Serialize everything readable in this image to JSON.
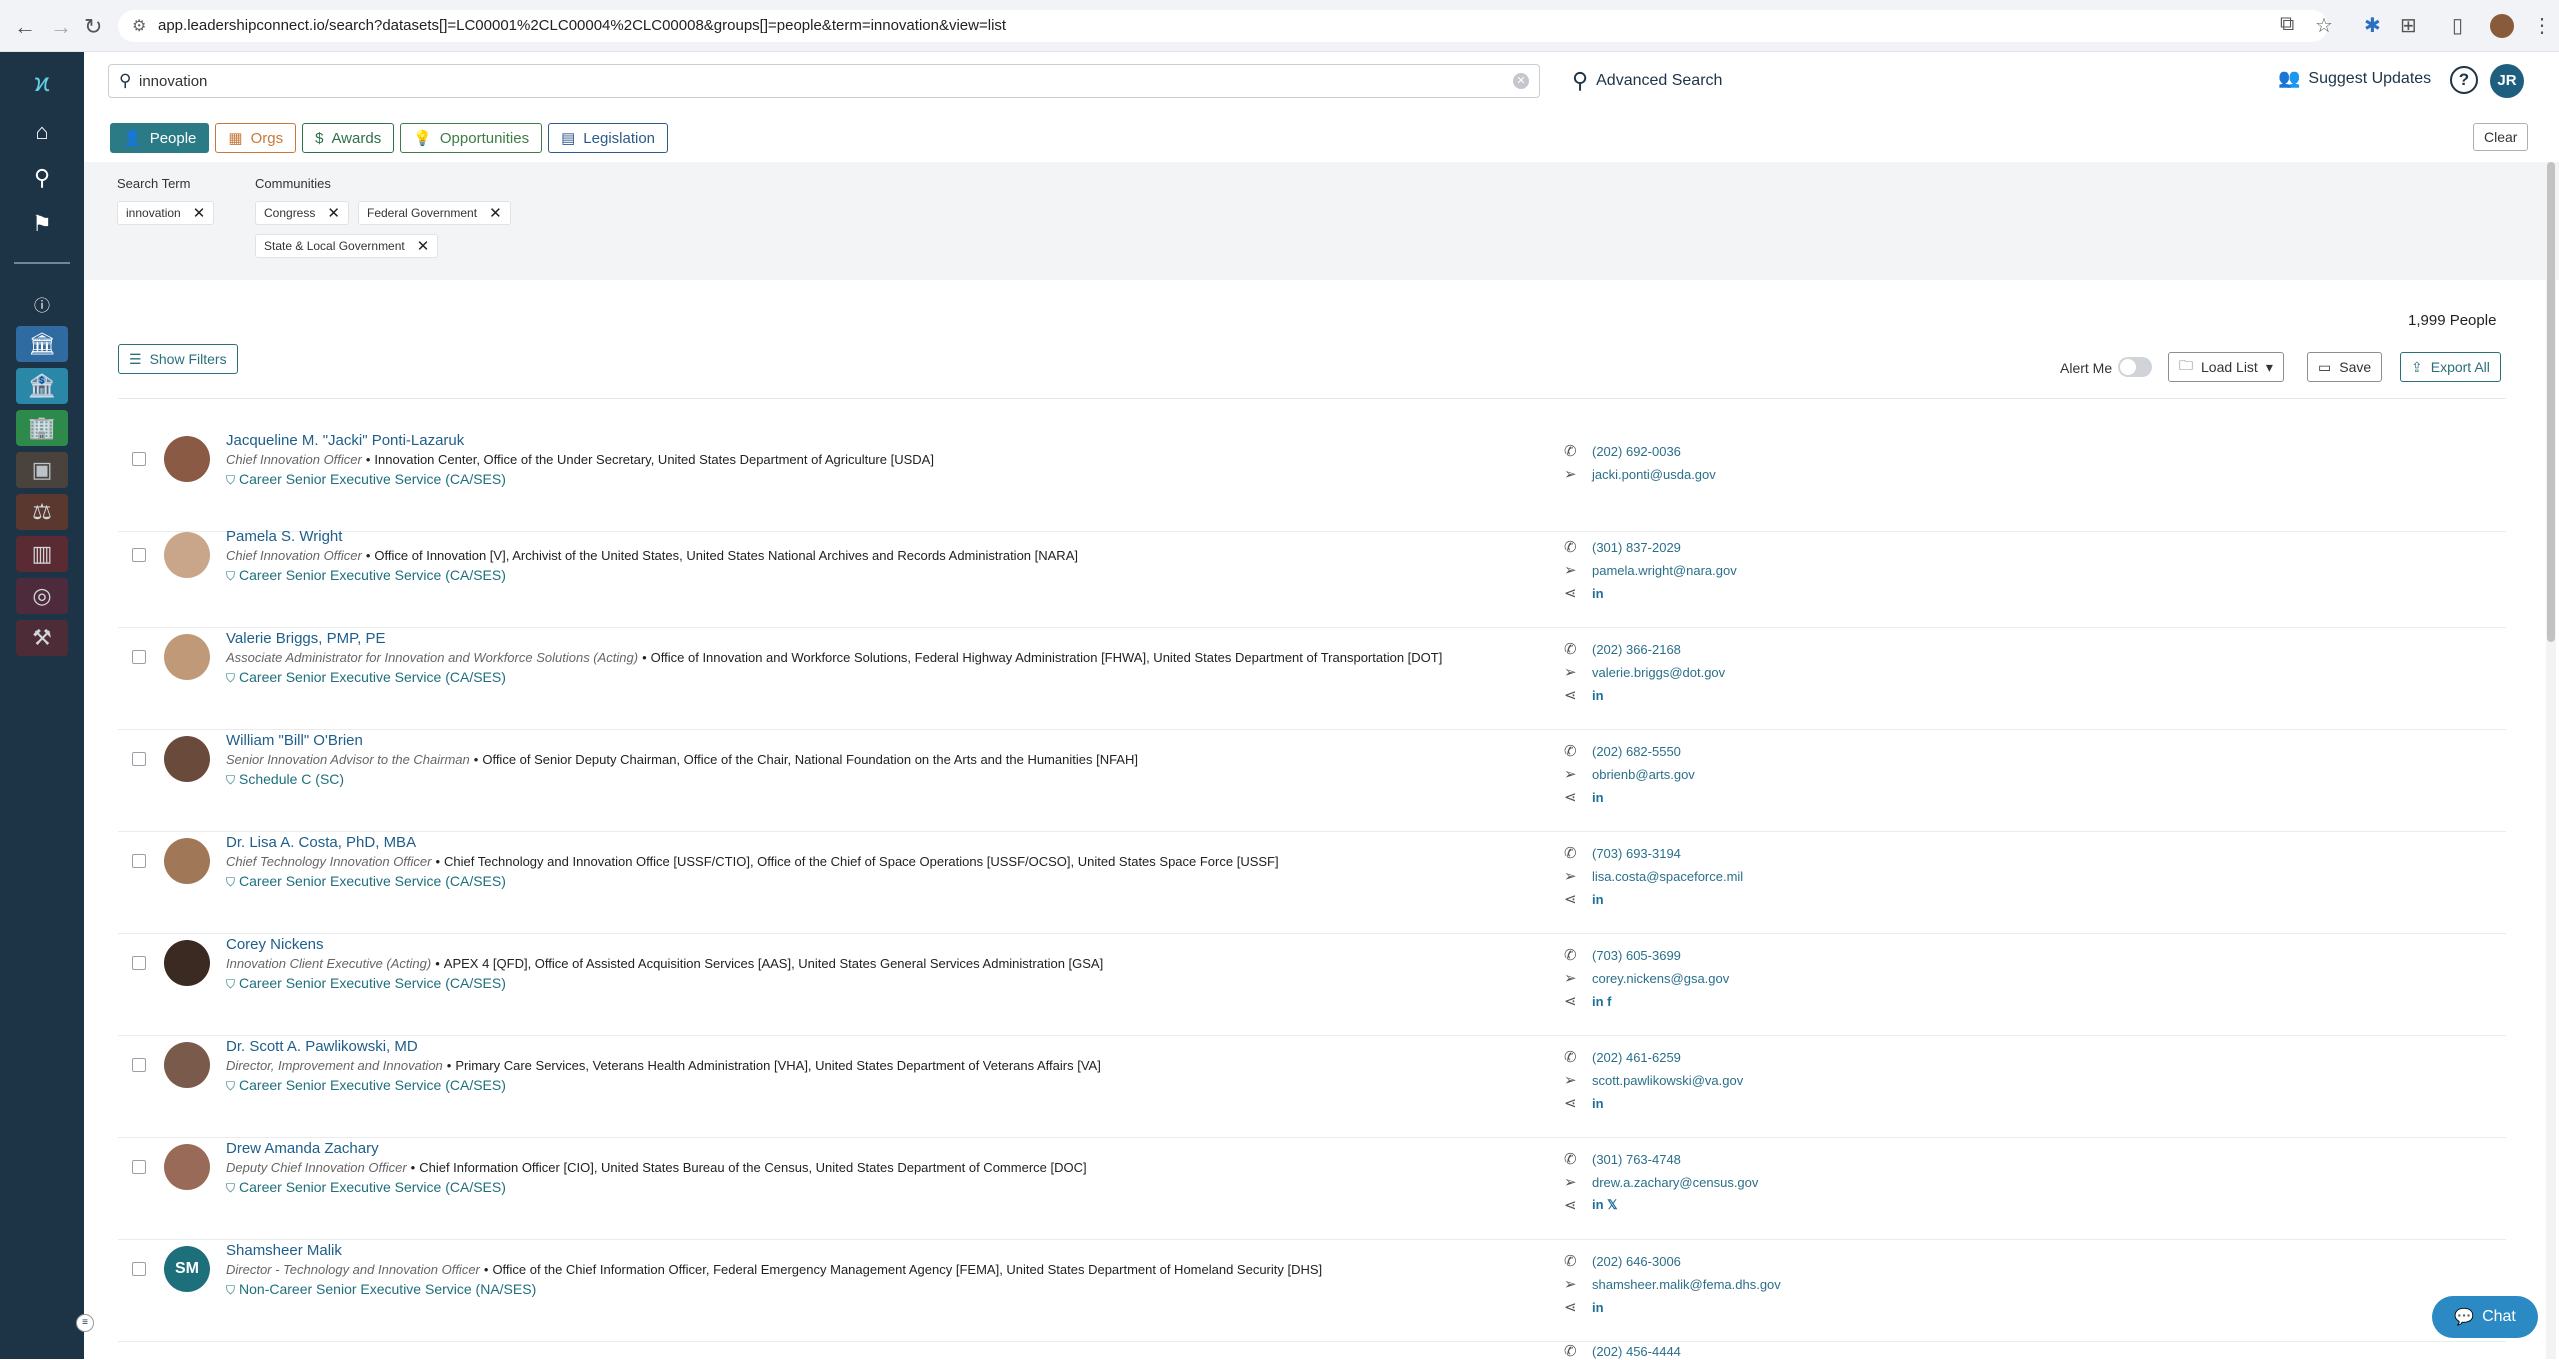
{
  "browser": {
    "url": "app.leadershipconnect.io/search?datasets[]=LC00001%2CLC00004%2CLC00008&groups[]=people&term=innovation&view=list"
  },
  "header": {
    "search_value": "innovation",
    "advanced_search": "Advanced Search",
    "suggest_updates": "Suggest Updates",
    "help": "?",
    "user_initials": "JR"
  },
  "tabs": [
    {
      "label": "People",
      "icon": "person-icon"
    },
    {
      "label": "Orgs",
      "icon": "building-icon"
    },
    {
      "label": "Awards",
      "icon": "dollar-icon"
    },
    {
      "label": "Opportunities",
      "icon": "lightbulb-icon"
    },
    {
      "label": "Legislation",
      "icon": "document-icon"
    }
  ],
  "clear_label": "Clear",
  "filters": {
    "search_term_label": "Search Term",
    "search_term_chip": "innovation",
    "communities_label": "Communities",
    "communities": [
      "Congress",
      "Federal Government",
      "State & Local Government"
    ]
  },
  "results": {
    "count_text": "1,999 People",
    "show_filters": "Show Filters",
    "alert_me": "Alert Me",
    "load_list": "Load List",
    "save": "Save",
    "export_all": "Export All"
  },
  "people": [
    {
      "name": "Jacqueline M. \"Jacki\" Ponti-Lazaruk",
      "title": "Chief Innovation Officer",
      "org": "Innovation Center, Office of the Under Secretary, United States Department of Agriculture [USDA]",
      "service": "Career Senior Executive Service (CA/SES)",
      "phone": "(202) 692-0036",
      "email": "jacki.ponti@usda.gov",
      "social": ""
    },
    {
      "name": "Pamela S. Wright",
      "title": "Chief Innovation Officer",
      "org": "Office of Innovation [V], Archivist of the United States, United States National Archives and Records Administration [NARA]",
      "service": "Career Senior Executive Service (CA/SES)",
      "phone": "(301) 837-2029",
      "email": "pamela.wright@nara.gov",
      "social": "in"
    },
    {
      "name": "Valerie Briggs, PMP, PE",
      "title": "Associate Administrator for Innovation and Workforce Solutions (Acting)",
      "org": "Office of Innovation and Workforce Solutions, Federal Highway Administration [FHWA], United States Department of Transportation [DOT]",
      "service": "Career Senior Executive Service (CA/SES)",
      "phone": "(202) 366-2168",
      "email": "valerie.briggs@dot.gov",
      "social": "in"
    },
    {
      "name": "William \"Bill\" O'Brien",
      "title": "Senior Innovation Advisor to the Chairman",
      "org": "Office of Senior Deputy Chairman, Office of the Chair, National Foundation on the Arts and the Humanities [NFAH]",
      "service": "Schedule C (SC)",
      "phone": "(202) 682-5550",
      "email": "obrienb@arts.gov",
      "social": "in"
    },
    {
      "name": "Dr. Lisa A. Costa, PhD, MBA",
      "title": "Chief Technology Innovation Officer",
      "org": "Chief Technology and Innovation Office [USSF/CTIO], Office of the Chief of Space Operations [USSF/OCSO], United States Space Force [USSF]",
      "service": "Career Senior Executive Service (CA/SES)",
      "phone": "(703) 693-3194",
      "email": "lisa.costa@spaceforce.mil",
      "social": "in"
    },
    {
      "name": "Corey Nickens",
      "title": "Innovation Client Executive (Acting)",
      "org": "APEX 4 [QFD], Office of Assisted Acquisition Services [AAS], United States General Services Administration [GSA]",
      "service": "Career Senior Executive Service (CA/SES)",
      "phone": "(703) 605-3699",
      "email": "corey.nickens@gsa.gov",
      "social": "in  f"
    },
    {
      "name": "Dr. Scott A. Pawlikowski, MD",
      "title": "Director, Improvement and Innovation",
      "org": "Primary Care Services, Veterans Health Administration [VHA], United States Department of Veterans Affairs [VA]",
      "service": "Career Senior Executive Service (CA/SES)",
      "phone": "(202) 461-6259",
      "email": "scott.pawlikowski@va.gov",
      "social": "in"
    },
    {
      "name": "Drew Amanda Zachary",
      "title": "Deputy Chief Innovation Officer",
      "org": "Chief Information Officer [CIO], United States Bureau of the Census, United States Department of Commerce [DOC]",
      "service": "Career Senior Executive Service (CA/SES)",
      "phone": "(301) 763-4748",
      "email": "drew.a.zachary@census.gov",
      "social": "in  𝕏"
    },
    {
      "name": "Shamsheer Malik",
      "initials": "SM",
      "title": "Director - Technology and Innovation Officer",
      "org": "Office of the Chief Information Officer, Federal Emergency Management Agency [FEMA], United States Department of Homeland Security [DHS]",
      "service": "Non-Career Senior Executive Service (NA/SES)",
      "phone": "(202) 646-3006",
      "email": "shamsheer.malik@fema.dhs.gov",
      "social": "in"
    }
  ],
  "partial_row_phone": "(202) 456-4444",
  "chat_label": "Chat"
}
